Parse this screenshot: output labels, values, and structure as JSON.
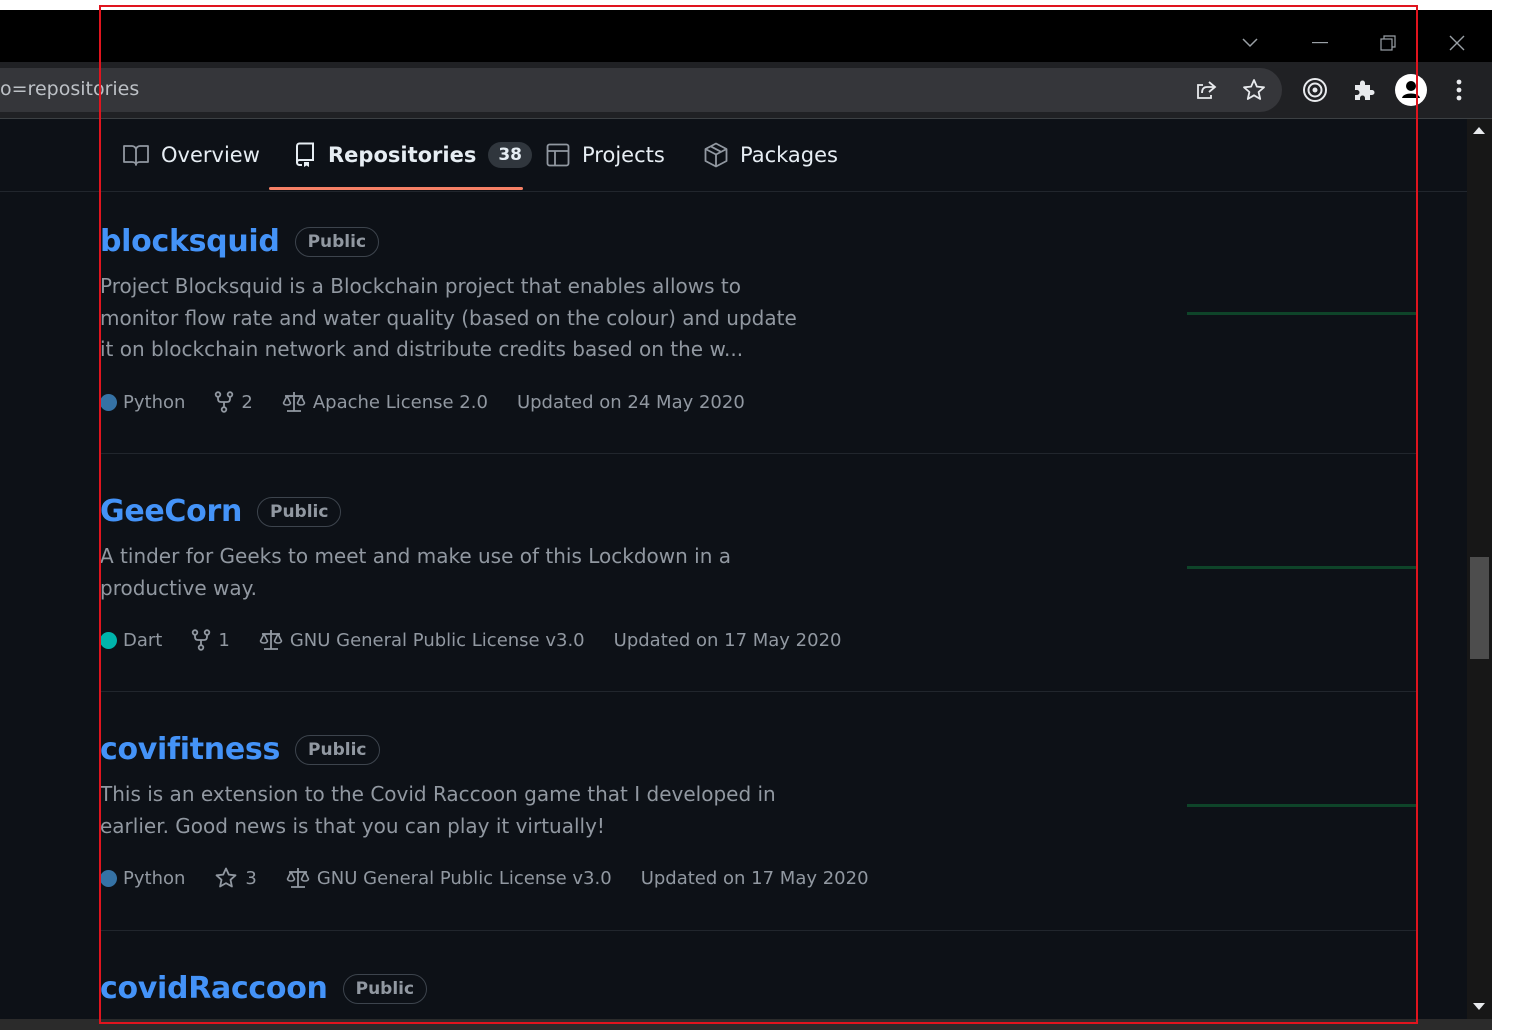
{
  "browser": {
    "url_fragment": "o=repositories",
    "toolbar_icons": [
      "share-icon",
      "bookmark-star-icon",
      "extension-target-icon",
      "extensions-puzzle-icon",
      "profile-avatar-icon",
      "menu-dots-icon"
    ],
    "window_controls": [
      "tab-search-chevron-icon",
      "minimize-icon",
      "restore-icon",
      "close-icon"
    ]
  },
  "tabs": [
    {
      "label": "Overview",
      "icon": "book-icon",
      "active": false
    },
    {
      "label": "Repositories",
      "icon": "repo-icon",
      "active": true,
      "count": "38"
    },
    {
      "label": "Projects",
      "icon": "table-icon",
      "active": false
    },
    {
      "label": "Packages",
      "icon": "package-icon",
      "active": false
    }
  ],
  "repos": [
    {
      "name": "blocksquid",
      "visibility": "Public",
      "description": "Project Blocksquid is a Blockchain project that enables allows to monitor flow rate and water quality (based on the colour) and update it on blockchain network and distribute credits based on the w...",
      "language": "Python",
      "language_color": "#3572A5",
      "stat_icon": "fork-icon",
      "stat_value": "2",
      "license": "Apache License 2.0",
      "updated": "Updated on 24 May 2020"
    },
    {
      "name": "GeeCorn",
      "visibility": "Public",
      "description": "A tinder for Geeks to meet and make use of this Lockdown in a productive way.",
      "language": "Dart",
      "language_color": "#00B4AB",
      "stat_icon": "fork-icon",
      "stat_value": "1",
      "license": "GNU General Public License v3.0",
      "updated": "Updated on 17 May 2020"
    },
    {
      "name": "covifitness",
      "visibility": "Public",
      "description": "This is an extension to the Covid Raccoon game that I developed in earlier. Good news is that you can play it virtually!",
      "language": "Python",
      "language_color": "#3572A5",
      "stat_icon": "star-icon",
      "stat_value": "3",
      "license": "GNU General Public License v3.0",
      "updated": "Updated on 17 May 2020"
    },
    {
      "name": "covidRaccoon",
      "visibility": "Public"
    }
  ],
  "colors": {
    "page_bg": "#0d1117",
    "link": "#4493f8",
    "muted": "#9198a1",
    "tab_underline": "#f78166",
    "highlight_border": "#e0141e"
  }
}
